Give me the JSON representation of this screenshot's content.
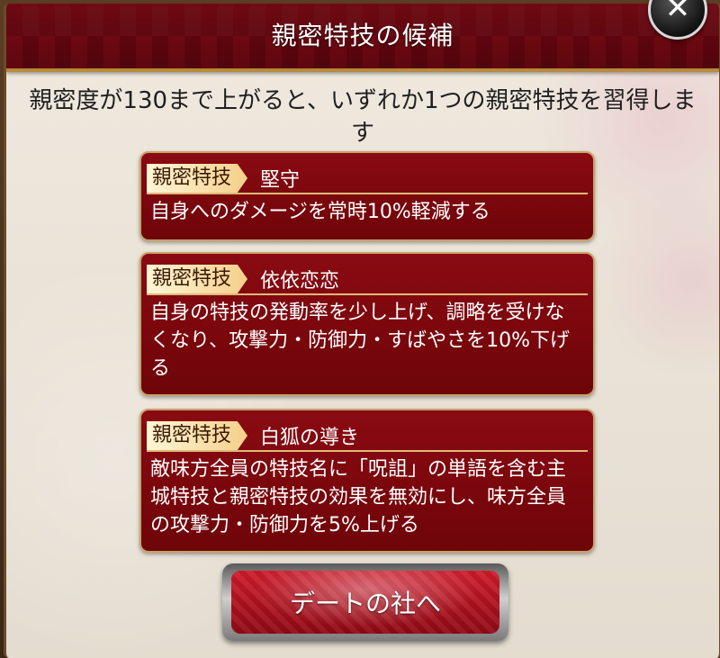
{
  "dialog": {
    "title": "親密特技の候補",
    "close_symbol": "✕",
    "intro": "親密度が130まで上がると、いずれか1つの親密特技を習得します"
  },
  "skills": [
    {
      "tag": "親密特技",
      "name": "堅守",
      "description": "自身へのダメージを常時10%軽減する"
    },
    {
      "tag": "親密特技",
      "name": "依依恋恋",
      "description": "自身の特技の発動率を少し上げ、調略を受けなくなり、攻撃力・防御力・すばやさを10%下げる"
    },
    {
      "tag": "親密特技",
      "name": "白狐の導き",
      "description": "敵味方全員の特技名に「呪詛」の単語を含む主城特技と親密特技の効果を無効にし、味方全員の攻撃力・防御力を5%上げる"
    }
  ],
  "actions": {
    "goto_label": "デートの社へ"
  },
  "icons": {
    "close": "close-icon"
  },
  "colors": {
    "header": "#730810",
    "card": "#8a0a12",
    "tag": "#f5cf8a",
    "button": "#d11b2b"
  }
}
